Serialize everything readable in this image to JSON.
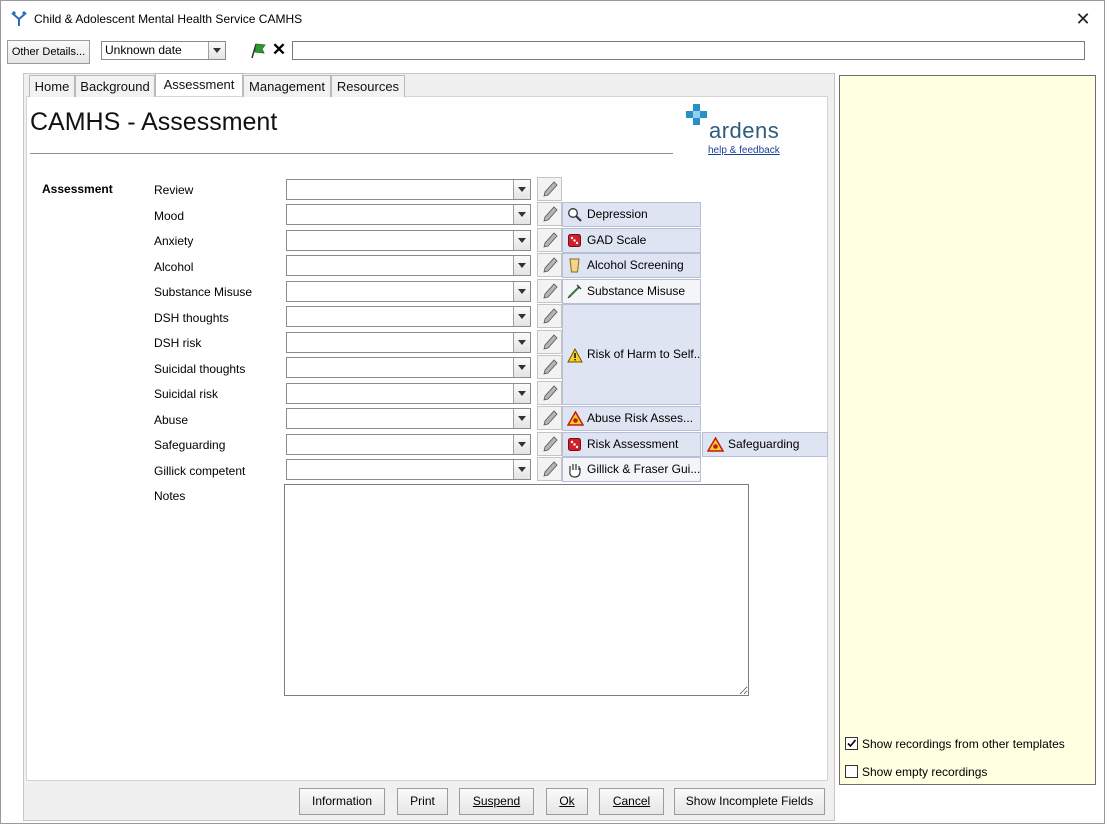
{
  "window": {
    "title": "Child & Adolescent Mental Health Service CAMHS"
  },
  "toolbar": {
    "other_details_label": "Other Details...",
    "date_value": "Unknown date",
    "entry_value": ""
  },
  "tabs": [
    {
      "label": "Home"
    },
    {
      "label": "Background"
    },
    {
      "label": "Assessment"
    },
    {
      "label": "Management"
    },
    {
      "label": "Resources"
    }
  ],
  "active_tab": "Assessment",
  "page": {
    "title": "CAMHS - Assessment",
    "logo_text": "ardens",
    "help_link": "help & feedback",
    "section_label": "Assessment"
  },
  "rows": [
    {
      "label": "Review",
      "value": ""
    },
    {
      "label": "Mood",
      "value": ""
    },
    {
      "label": "Anxiety",
      "value": ""
    },
    {
      "label": "Alcohol",
      "value": ""
    },
    {
      "label": "Substance Misuse",
      "value": ""
    },
    {
      "label": "DSH thoughts",
      "value": ""
    },
    {
      "label": "DSH risk",
      "value": ""
    },
    {
      "label": "Suicidal thoughts",
      "value": ""
    },
    {
      "label": "Suicidal risk",
      "value": ""
    },
    {
      "label": "Abuse",
      "value": ""
    },
    {
      "label": "Safeguarding",
      "value": ""
    },
    {
      "label": "Gillick competent",
      "value": ""
    }
  ],
  "tools": {
    "depression": {
      "label": "Depression",
      "icon": "magnifier-icon"
    },
    "gad_scale": {
      "label": "GAD Scale",
      "icon": "dice-icon"
    },
    "alcohol_screening": {
      "label": "Alcohol Screening",
      "icon": "glass-icon"
    },
    "substance_misuse": {
      "label": "Substance Misuse",
      "icon": "syringe-icon"
    },
    "risk_of_harm": {
      "label": "Risk of Harm to Self...",
      "icon": "warning-icon"
    },
    "abuse_risk": {
      "label": "Abuse Risk Asses...",
      "icon": "hazard-icon"
    },
    "risk_assessment": {
      "label": "Risk Assessment",
      "icon": "dice-icon"
    },
    "safeguarding": {
      "label": "Safeguarding",
      "icon": "hazard-icon"
    },
    "gillick": {
      "label": "Gillick & Fraser Gui...",
      "icon": "hand-icon"
    }
  },
  "notes": {
    "label": "Notes",
    "value": ""
  },
  "footer": {
    "information": "Information",
    "print": "Print",
    "suspend": "Suspend",
    "ok": "Ok",
    "cancel": "Cancel",
    "show_incomplete": "Show Incomplete Fields"
  },
  "right_panel": {
    "show_other_templates": {
      "label": "Show recordings from other templates",
      "checked": true
    },
    "show_empty": {
      "label": "Show empty recordings",
      "checked": false
    }
  },
  "colors": {
    "accent_tool_bg": "#dfe4f2",
    "right_panel_bg": "#ffffe1",
    "logo": "#2d5d7b",
    "link": "#1a3f9c"
  }
}
